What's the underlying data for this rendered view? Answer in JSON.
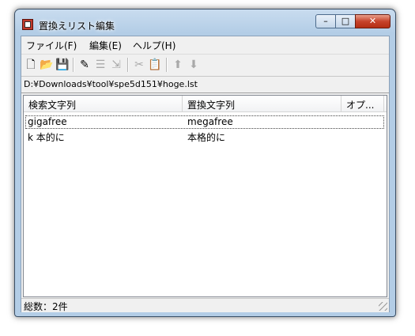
{
  "window": {
    "title": "置換えリスト編集",
    "minimize_glyph": "–",
    "maximize_glyph": "□",
    "close_glyph": "✕"
  },
  "menu": {
    "items": [
      {
        "label": "ファイル(F)"
      },
      {
        "label": "編集(E)"
      },
      {
        "label": "ヘルプ(H)"
      }
    ]
  },
  "toolbar": {
    "buttons": [
      {
        "icon": "new-file-icon",
        "glyph": "🗋",
        "enabled": true
      },
      {
        "icon": "open-folder-icon",
        "glyph": "📂",
        "enabled": true
      },
      {
        "icon": "save-icon",
        "glyph": "💾",
        "enabled": true
      },
      {
        "icon": "edit-icon",
        "glyph": "✎",
        "enabled": true
      },
      {
        "icon": "list-icon",
        "glyph": "☰",
        "enabled": false
      },
      {
        "icon": "export-icon",
        "glyph": "⇲",
        "enabled": false
      },
      {
        "icon": "cut-icon",
        "glyph": "✂",
        "enabled": false
      },
      {
        "icon": "paste-icon",
        "glyph": "📋",
        "enabled": false
      },
      {
        "icon": "move-up-icon",
        "glyph": "⬆",
        "enabled": false
      },
      {
        "icon": "move-down-icon",
        "glyph": "⬇",
        "enabled": false
      }
    ]
  },
  "path": "D:¥Downloads¥tool¥spe5d151¥hoge.lst",
  "table": {
    "columns": [
      "検索文字列",
      "置換文字列",
      "オプ..."
    ],
    "rows": [
      {
        "search": "gigafree",
        "replace": "megafree",
        "option": ""
      },
      {
        "search": "k 本的に",
        "replace": "本格的に",
        "option": ""
      }
    ]
  },
  "status": {
    "text": "総数：2件"
  }
}
